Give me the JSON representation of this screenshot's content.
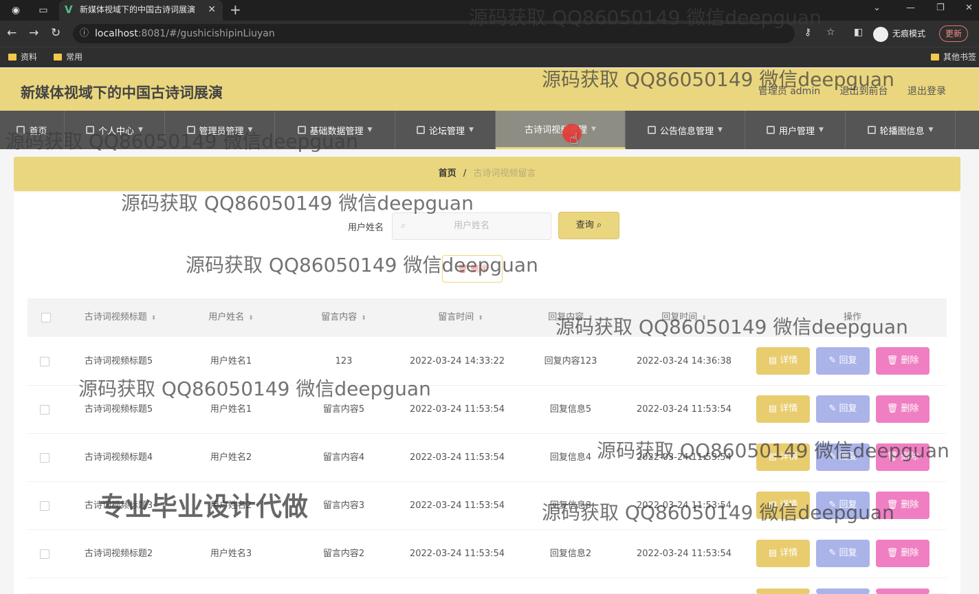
{
  "browser": {
    "tab_title": "新媒体视域下的中国古诗词展演",
    "url_host": "localhost",
    "url_path": ":8081/#/gushicishipinLiuyan",
    "incognito_label": "无痕模式",
    "update_label": "更新",
    "bookmarks": [
      "资料",
      "常用"
    ],
    "other_bookmarks": "其他书签"
  },
  "app": {
    "title": "新媒体视域下的中国古诗词展演",
    "user_label": "管理员 admin",
    "back_to_front": "退出到前台",
    "logout": "退出登录"
  },
  "nav": {
    "items": [
      {
        "label": "首页"
      },
      {
        "label": "个人中心"
      },
      {
        "label": "管理员管理"
      },
      {
        "label": "基础数据管理"
      },
      {
        "label": "论坛管理"
      },
      {
        "label": "古诗词视频管理"
      },
      {
        "label": "公告信息管理"
      },
      {
        "label": "用户管理"
      },
      {
        "label": "轮播图信息"
      }
    ]
  },
  "breadcrumb": {
    "home": "首页",
    "sep": "/",
    "current": "古诗词视频留言"
  },
  "search": {
    "label": "用户姓名",
    "placeholder": "用户姓名",
    "button": "查询"
  },
  "toolbar": {
    "delete": "删除"
  },
  "table": {
    "headers": [
      "古诗词视频标题",
      "用户姓名",
      "留言内容",
      "留言时间",
      "回复内容",
      "回复时间",
      "操作"
    ],
    "rows": [
      [
        "古诗词视频标题5",
        "用户姓名1",
        "123",
        "2022-03-24 14:33:22",
        "回复内容123",
        "2022-03-24 14:36:38"
      ],
      [
        "古诗词视频标题5",
        "用户姓名1",
        "留言内容5",
        "2022-03-24 11:53:54",
        "回复信息5",
        "2022-03-24 11:53:54"
      ],
      [
        "古诗词视频标题4",
        "用户姓名2",
        "留言内容4",
        "2022-03-24 11:53:54",
        "回复信息4",
        "2022-03-24 11:53:54"
      ],
      [
        "古诗词视频标题3",
        "用户姓名2",
        "留言内容3",
        "2022-03-24 11:53:54",
        "回复信息3",
        "2022-03-24 11:53:54"
      ],
      [
        "古诗词视频标题2",
        "用户姓名3",
        "留言内容2",
        "2022-03-24 11:53:54",
        "回复信息2",
        "2022-03-24 11:53:54"
      ]
    ],
    "actions": {
      "detail": "详情",
      "reply": "回复",
      "delete": "删除"
    }
  },
  "watermark": {
    "text": "源码获取 QQ86050149 微信deepguan",
    "big": "专业毕业设计代做"
  },
  "colors": {
    "theme_yellow": "#ead67f",
    "nav_gray": "#555555",
    "btn_pink": "#ef7fc2",
    "btn_blue": "#aab4e8"
  }
}
